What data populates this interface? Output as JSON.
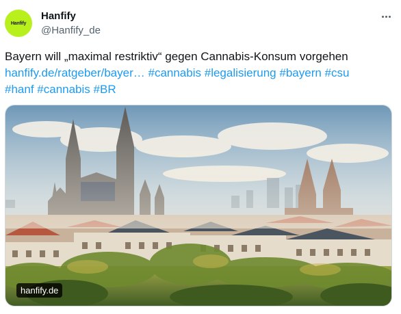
{
  "author": {
    "avatar_text": "Hanfify",
    "display_name": "Hanfify",
    "handle": "@Hanfify_de"
  },
  "tweet": {
    "text": "Bayern will „maximal restriktiv“ gegen Cannabis-Konsum vorgehen",
    "link": "hanfify.de/ratgeber/bayer…",
    "hashtags_line1": [
      "#cannabis",
      "#legalisierung",
      "#bayern",
      "#csu"
    ],
    "hashtags_line2": [
      "#hanf",
      "#cannabis",
      "#BR"
    ]
  },
  "media": {
    "domain_badge": "hanfify.de"
  },
  "icons": {
    "more": "more-horizontal-icon"
  },
  "colors": {
    "link": "#1d9bf0",
    "avatar_bg": "#b8f01d",
    "secondary_text": "#536471"
  }
}
